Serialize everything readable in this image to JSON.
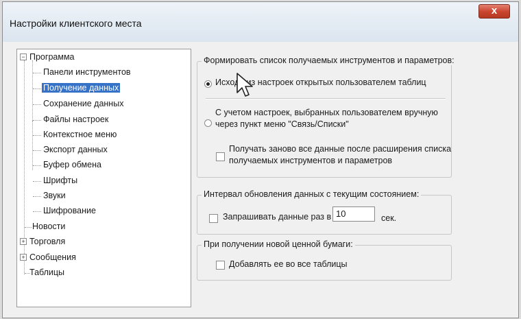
{
  "window": {
    "title": "Настройки клиентского места",
    "close_label": "x"
  },
  "tree": {
    "programma": "Программа",
    "paneli": "Панели инструментов",
    "poluchenie": "Получение данных",
    "sohranenie": "Сохранение данных",
    "faily": "Файлы настроек",
    "kontekst": "Контекстное меню",
    "eksport": "Экспорт данных",
    "bufer": "Буфер обмена",
    "shrifty": "Шрифты",
    "zvuki": "Звуки",
    "shifrovanie": "Шифрование",
    "novosti": "Новости",
    "torgovlya": "Торговля",
    "soobscheniya": "Сообщения",
    "tablicy": "Таблицы"
  },
  "group1": {
    "legend": "Формировать список получаемых инструментов и параметров:",
    "radio1": "Исходя из настроек открытых пользователем таблиц",
    "radio2_line1": "С учетом настроек, выбранных пользователем вручную",
    "radio2_line2": "через пункт меню \"Связь/Списки\"",
    "check_line1": "Получать заново все данные после расширения списка",
    "check_line2": "получаемых инструментов и параметров"
  },
  "group2": {
    "legend": "Интервал обновления данных с текущим состоянием:",
    "check_label": "Запрашивать данные раз в",
    "interval_value": "10",
    "unit": "сек."
  },
  "group3": {
    "legend": "При получении новой ценной бумаги:",
    "check_label": "Добавлять ее во все таблицы"
  }
}
